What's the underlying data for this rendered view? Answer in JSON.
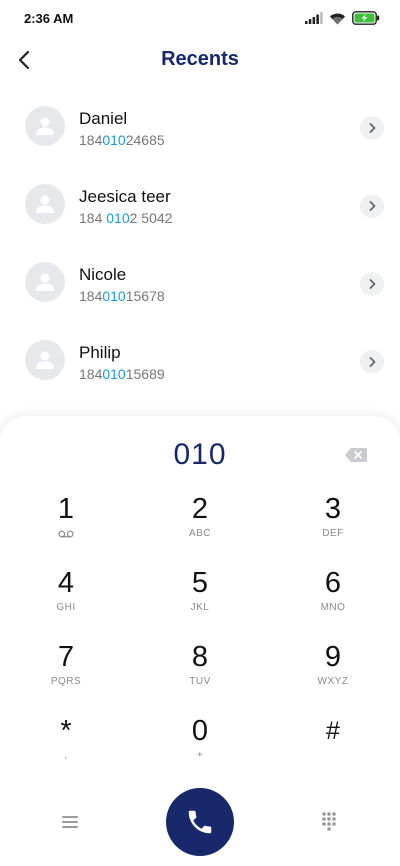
{
  "status_bar": {
    "time": "2:36 AM",
    "icons": [
      "signal-icon",
      "wifi-icon",
      "battery-charging-icon"
    ],
    "battery_color": "#3fbf3a"
  },
  "header": {
    "title": "Recents",
    "back_icon": "chevron-left-icon",
    "title_color": "#17296b"
  },
  "recents": [
    {
      "name": "Daniel",
      "number_parts": [
        "184",
        "010",
        "24685"
      ]
    },
    {
      "name": "Jeesica teer",
      "number_parts": [
        "184 ",
        "010",
        "2 5042"
      ]
    },
    {
      "name": "Nicole",
      "number_parts": [
        "184",
        "010",
        "15678"
      ]
    },
    {
      "name": "Philip",
      "number_parts": [
        "184",
        "010",
        "15689"
      ]
    }
  ],
  "match_color": "#1a9ad6",
  "dialpad": {
    "input_value": "010",
    "backspace_icon": "backspace-icon",
    "keys": [
      {
        "digit": "1",
        "letters": "",
        "icon": "voicemail-icon"
      },
      {
        "digit": "2",
        "letters": "ABC"
      },
      {
        "digit": "3",
        "letters": "DEF"
      },
      {
        "digit": "4",
        "letters": "GHI"
      },
      {
        "digit": "5",
        "letters": "JKL"
      },
      {
        "digit": "6",
        "letters": "MNO"
      },
      {
        "digit": "7",
        "letters": "PQRS"
      },
      {
        "digit": "8",
        "letters": "TUV"
      },
      {
        "digit": "9",
        "letters": "WXYZ"
      },
      {
        "digit": "*",
        "letters": ","
      },
      {
        "digit": "0",
        "letters": "+"
      },
      {
        "digit": "#",
        "letters": ""
      }
    ]
  },
  "bottom_bar": {
    "menu_icon": "menu-icon",
    "call_icon": "phone-icon",
    "keypad_icon": "dialpad-icon",
    "call_color": "#17296b"
  }
}
